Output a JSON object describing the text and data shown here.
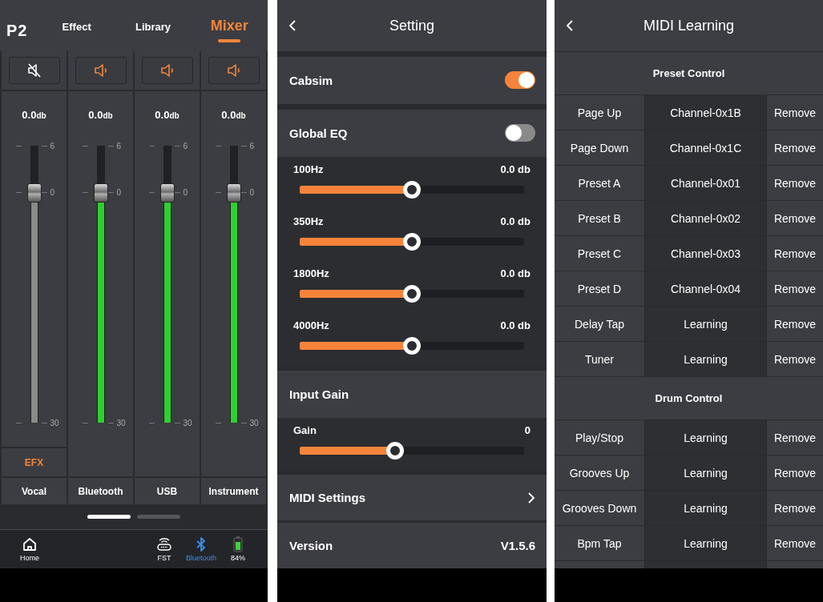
{
  "mixer": {
    "logo": "P2",
    "tabs": [
      {
        "label": "Effect",
        "selected": false
      },
      {
        "label": "Library",
        "selected": false
      },
      {
        "label": "Mixer",
        "selected": true
      }
    ],
    "channels": [
      {
        "name": "Vocal",
        "value": "0.0",
        "unit": "db",
        "muted": true,
        "level": 0.83,
        "scale": [
          "6",
          "0",
          "30"
        ],
        "efx": "EFX"
      },
      {
        "name": "Bluetooth",
        "value": "0.0",
        "unit": "db",
        "muted": false,
        "level": 0.83,
        "scale": [
          "6",
          "0",
          "30"
        ]
      },
      {
        "name": "USB",
        "value": "0.0",
        "unit": "db",
        "muted": false,
        "level": 0.83,
        "scale": [
          "6",
          "0",
          "30"
        ]
      },
      {
        "name": "Instrument",
        "value": "0.0",
        "unit": "db",
        "muted": false,
        "level": 0.83,
        "scale": [
          "6",
          "0",
          "30"
        ]
      }
    ],
    "pages": [
      {
        "selected": true
      },
      {
        "selected": false
      }
    ],
    "nav": [
      {
        "kind": "home",
        "label": "Home",
        "active": false
      },
      {
        "kind": "fst",
        "label": "FST",
        "active": false
      },
      {
        "kind": "bluetooth",
        "label": "Bluetooth",
        "active": true
      },
      {
        "kind": "battery",
        "label": "84%",
        "active": false
      }
    ]
  },
  "settings": {
    "title": "Setting",
    "sections": [
      {
        "kind": "toggle",
        "label": "Cabsim",
        "on": true
      },
      {
        "kind": "toggle",
        "label": "Global EQ",
        "on": false,
        "sliders": [
          {
            "label": "100Hz",
            "value": "0.0 db",
            "level": 0.5
          },
          {
            "label": "350Hz",
            "value": "0.0 db",
            "level": 0.5
          },
          {
            "label": "1800Hz",
            "value": "0.0 db",
            "level": 0.5
          },
          {
            "label": "4000Hz",
            "value": "0.0 db",
            "level": 0.5
          }
        ]
      },
      {
        "kind": "header",
        "label": "Input Gain",
        "sliders": [
          {
            "label": "Gain",
            "value": "0",
            "level": 0.425
          }
        ]
      },
      {
        "kind": "link",
        "label": "MIDI Settings"
      },
      {
        "kind": "info",
        "label": "Version",
        "value": "V1.5.6"
      }
    ]
  },
  "midi": {
    "title": "MIDI Learning",
    "groups": [
      {
        "title": "Preset Control",
        "rows": [
          {
            "action": "Page Up",
            "binding": "Channel-0x1B",
            "remove": "Remove"
          },
          {
            "action": "Page Down",
            "binding": "Channel-0x1C",
            "remove": "Remove"
          },
          {
            "action": "Preset A",
            "binding": "Channel-0x01",
            "remove": "Remove"
          },
          {
            "action": "Preset B",
            "binding": "Channel-0x02",
            "remove": "Remove"
          },
          {
            "action": "Preset C",
            "binding": "Channel-0x03",
            "remove": "Remove"
          },
          {
            "action": "Preset D",
            "binding": "Channel-0x04",
            "remove": "Remove"
          },
          {
            "action": "Delay Tap",
            "binding": "Learning",
            "remove": "Remove"
          },
          {
            "action": "Tuner",
            "binding": "Learning",
            "remove": "Remove"
          }
        ]
      },
      {
        "title": "Drum Control",
        "rows": [
          {
            "action": "Play/Stop",
            "binding": "Learning",
            "remove": "Remove"
          },
          {
            "action": "Grooves Up",
            "binding": "Learning",
            "remove": "Remove"
          },
          {
            "action": "Grooves Down",
            "binding": "Learning",
            "remove": "Remove"
          },
          {
            "action": "Bpm Tap",
            "binding": "Learning",
            "remove": "Remove"
          }
        ]
      }
    ]
  }
}
